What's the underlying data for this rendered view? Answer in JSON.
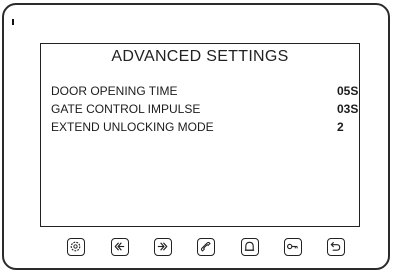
{
  "screen": {
    "title": "ADVANCED SETTINGS",
    "settings": [
      {
        "label": "DOOR OPENING TIME",
        "value": "05S"
      },
      {
        "label": "GATE CONTROL IMPULSE",
        "value": "03S"
      },
      {
        "label": "EXTEND UNLOCKING MODE",
        "value": "2"
      }
    ]
  },
  "buttons": [
    {
      "icon": "settings-icon"
    },
    {
      "icon": "arrow-left-icon"
    },
    {
      "icon": "arrow-right-icon"
    },
    {
      "icon": "phone-icon"
    },
    {
      "icon": "bell-icon"
    },
    {
      "icon": "key-icon"
    },
    {
      "icon": "return-icon"
    }
  ],
  "colors": {
    "frame": "#2a2a2a",
    "text": "#1c1c1c",
    "background": "#ffffff"
  }
}
